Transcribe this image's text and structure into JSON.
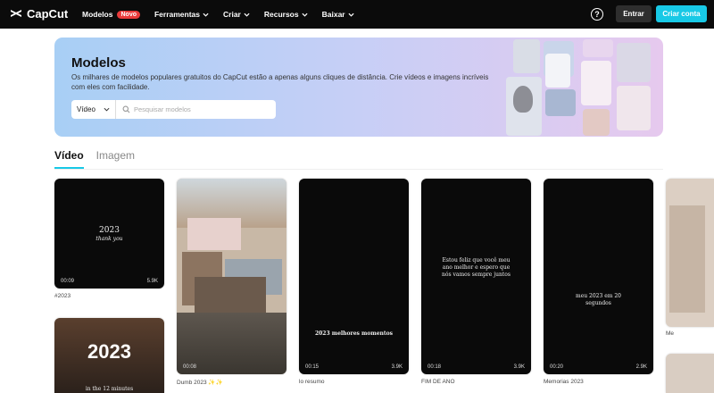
{
  "nav": {
    "logo": "CapCut",
    "items": [
      {
        "label": "Modelos",
        "badge": "Novo"
      },
      {
        "label": "Ferramentas"
      },
      {
        "label": "Criar"
      },
      {
        "label": "Recursos"
      },
      {
        "label": "Baixar"
      }
    ],
    "help": "?",
    "login": "Entrar",
    "signup": "Criar conta"
  },
  "hero": {
    "title": "Modelos",
    "description": "Os milhares de modelos populares gratuitos do CapCut estão a apenas alguns cliques de distância. Crie vídeos e imagens incríveis com eles com facilidade.",
    "search_type": "Vídeo",
    "search_placeholder": "Pesquisar modelos"
  },
  "tabs": [
    {
      "label": "Vídeo",
      "active": true
    },
    {
      "label": "Imagem",
      "active": false
    }
  ],
  "cards": [
    {
      "overlay": "2023",
      "overlay_sub": "thank you",
      "duration": "00:09",
      "likes": "5.9K",
      "caption": "#2023"
    },
    {
      "overlay": "",
      "duration": "00:08",
      "likes": "",
      "caption": "Dumb 2023 ✨✨"
    },
    {
      "overlay": "2023 melhores momentos",
      "duration": "00:15",
      "likes": "3.9K",
      "caption": "lo resumo"
    },
    {
      "overlay": "Estou feliz que você meu ano melhor e espero que nós vamos sempre juntos",
      "duration": "00:18",
      "likes": "3.9K",
      "caption": "FIM DE ANO"
    },
    {
      "overlay": "meu 2023 em 20 segundos",
      "duration": "00:20",
      "likes": "2.9K",
      "caption": "Memorias 2023"
    },
    {
      "overlay": "",
      "duration": "",
      "likes": "",
      "caption": "Me"
    },
    {
      "overlay": "2023",
      "overlay_sub": "in the 12 minutes",
      "duration": "",
      "likes": "",
      "caption": ""
    }
  ],
  "colors": {
    "nav_bg": "#0b0b0b",
    "accent": "#18c9e6",
    "badge": "#e93b3b"
  }
}
